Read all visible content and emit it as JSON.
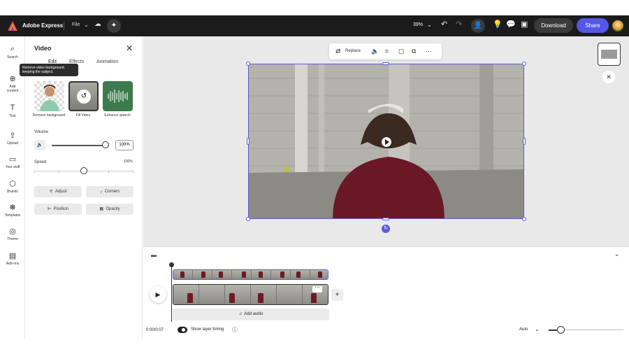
{
  "app": {
    "brand": "Adobe Express",
    "file_menu": "File"
  },
  "topbar": {
    "zoom": "39%",
    "download_label": "Download",
    "share_label": "Share",
    "share_color": "#5258e4"
  },
  "rail": {
    "items": [
      {
        "label": "Search",
        "icon": "search-icon"
      },
      {
        "label": "Add content",
        "icon": "plus-circle-icon"
      },
      {
        "label": "Text",
        "icon": "text-icon"
      },
      {
        "label": "Upload",
        "icon": "upload-icon"
      },
      {
        "label": "Your stuff",
        "icon": "folder-icon"
      },
      {
        "label": "Brands",
        "icon": "brand-icon"
      },
      {
        "label": "Templates",
        "icon": "templates-icon"
      },
      {
        "label": "Theme",
        "icon": "theme-icon"
      },
      {
        "label": "Add-ons",
        "icon": "addons-icon"
      }
    ]
  },
  "panel": {
    "title": "Video",
    "tabs": [
      "Edit",
      "Effects",
      "Animation"
    ],
    "tooltip": "Remove video background, keeping the subject.",
    "actions": [
      {
        "label": "Remove background"
      },
      {
        "label": "Fill Video"
      },
      {
        "label": "Enhance speech"
      }
    ],
    "volume_label": "Volume",
    "volume_value": "100%",
    "volume_level": 1.0,
    "speed_label": "Speed",
    "speed_value": "100%",
    "speed_level": 0.5,
    "buttons": {
      "adjust": "Adjust",
      "corners": "Corners",
      "position": "Position",
      "opacity": "Opacity"
    }
  },
  "canvas": {
    "toolbar": {
      "replace_label": "Replace"
    },
    "selection_color": "#5b5bd6"
  },
  "timeline": {
    "add_audio_label": "Add audio",
    "time": "0:00/0:07",
    "layer_timing_label": "Show layer timing",
    "layer_timing_on": true,
    "zoom_mode": "Auto"
  }
}
